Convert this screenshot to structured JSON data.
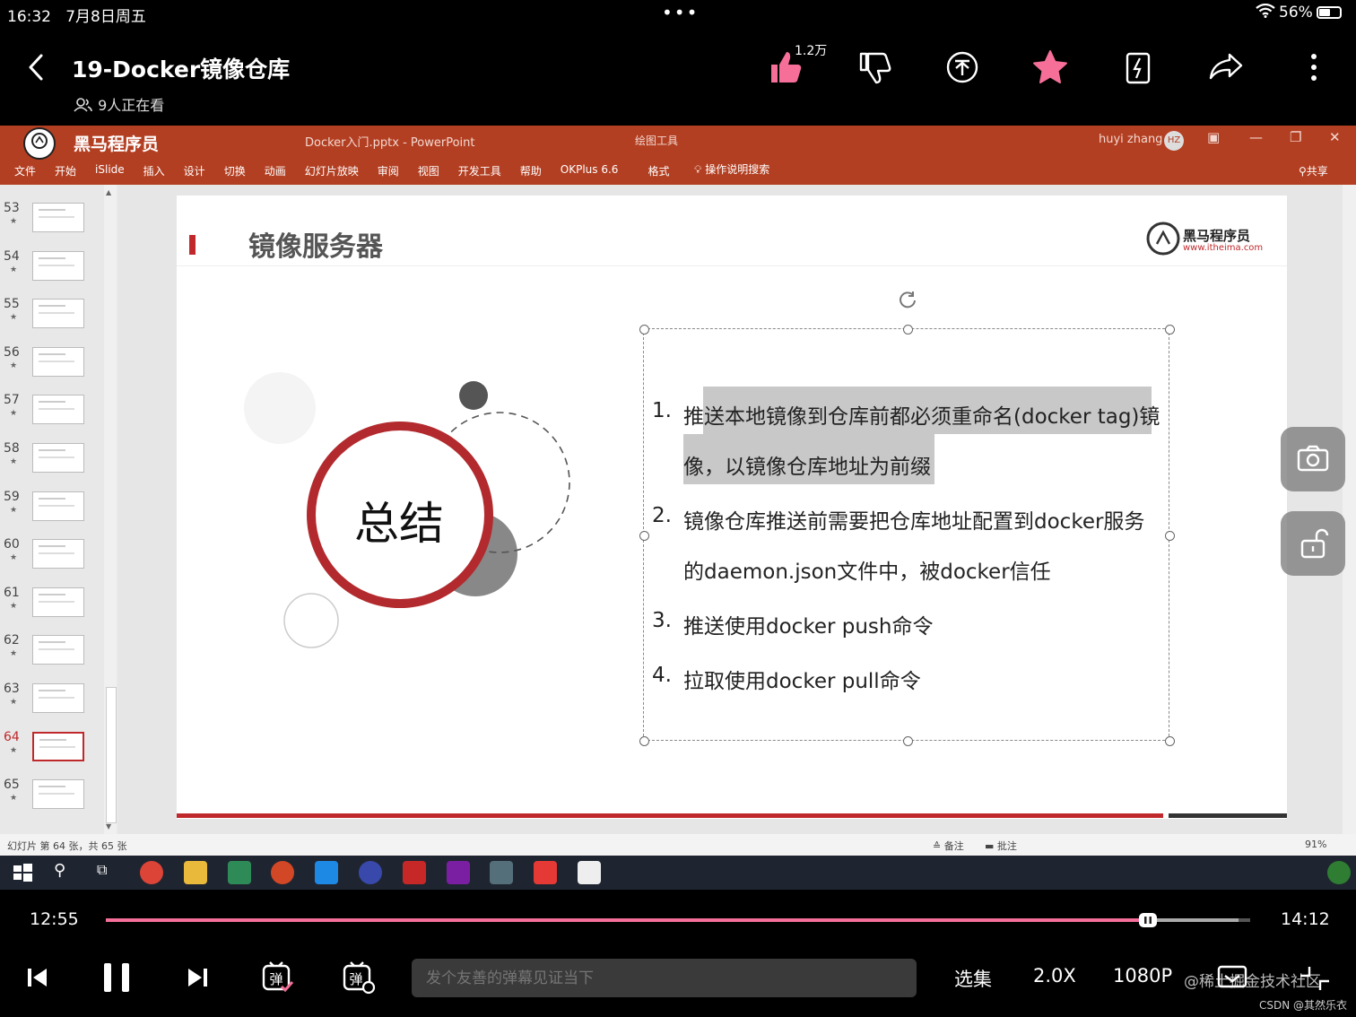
{
  "status_bar": {
    "time": "16:32",
    "date": "7月8日周五",
    "battery": "56%",
    "battery_level": 0.56
  },
  "header": {
    "title": "19-Docker镜像仓库",
    "viewers": "9人正在看",
    "like_count": "1.2万"
  },
  "ppt": {
    "window_title": "Docker入门.pptx  -  PowerPoint",
    "context_tool": "绘图工具",
    "user": "huyi zhang",
    "user_initials": "HZ",
    "logo_text": "黑马程序员",
    "ribbon_tabs": [
      "文件",
      "开始",
      "iSlide",
      "插入",
      "设计",
      "切换",
      "动画",
      "幻灯片放映",
      "审阅",
      "视图",
      "开发工具",
      "帮助",
      "OKPlus 6.6",
      "格式"
    ],
    "search_label": "操作说明搜索",
    "share_label": "共享",
    "thumbnails": [
      "53",
      "54",
      "55",
      "56",
      "57",
      "58",
      "59",
      "60",
      "61",
      "62",
      "63",
      "64",
      "65"
    ],
    "current_slide": "64",
    "status": {
      "slide_info": "幻灯片 第 64 张，共 65 张",
      "notes": "备注",
      "comments": "批注",
      "zoom": "91%"
    }
  },
  "slide": {
    "title": "镜像服务器",
    "logo_name": "黑马程序员",
    "logo_url": "www.itheima.com",
    "summary_label": "总结",
    "items": [
      {
        "num": "1.",
        "line1": "推送本地镜像到仓库前都必须重命名(docker tag)镜",
        "line2": "像，以镜像仓库地址为前缀"
      },
      {
        "num": "2.",
        "line1": "镜像仓库推送前需要把仓库地址配置到docker服务",
        "line2": "的daemon.json文件中，被docker信任"
      },
      {
        "num": "3.",
        "line1": "推送使用docker push命令"
      },
      {
        "num": "4.",
        "line1": "拉取使用docker pull命令"
      }
    ],
    "accent_color": "#c0292c"
  },
  "player": {
    "current_time": "12:55",
    "total_time": "14:12",
    "progress": 0.91,
    "danmaku_placeholder": "发个友善的弹幕见证当下",
    "episodes_label": "选集",
    "speed_label": "2.0X",
    "quality_label": "1080P",
    "watermark": "@稀土掘金技术社区",
    "watermark2": "CSDN @其然乐衣"
  }
}
